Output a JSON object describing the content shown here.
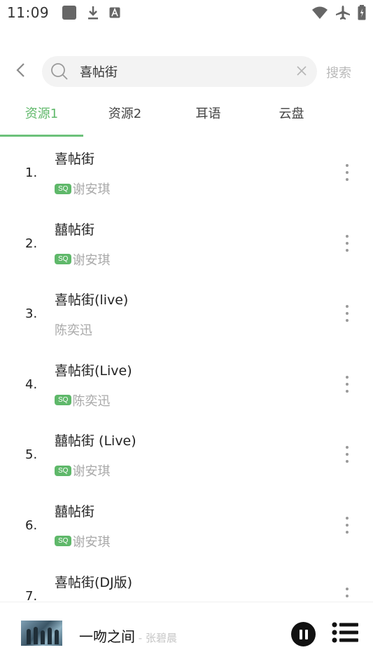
{
  "status_bar": {
    "time": "11:09",
    "left_icons": [
      "square-icon",
      "download-icon",
      "font-icon"
    ],
    "right_icons": [
      "wifi-icon",
      "airplane-icon",
      "battery-icon"
    ]
  },
  "search": {
    "value": "喜帖街",
    "submit_label": "搜索"
  },
  "tabs": [
    {
      "label": "资源1",
      "active": true
    },
    {
      "label": "资源2",
      "active": false
    },
    {
      "label": "耳语",
      "active": false
    },
    {
      "label": "云盘",
      "active": false
    }
  ],
  "results": [
    {
      "index": "1.",
      "title": "喜帖街",
      "badge": "SQ",
      "artist": "谢安琪"
    },
    {
      "index": "2.",
      "title": "囍帖街",
      "badge": "SQ",
      "artist": "谢安琪"
    },
    {
      "index": "3.",
      "title": "喜帖街(live)",
      "badge": "",
      "artist": "陈奕迅"
    },
    {
      "index": "4.",
      "title": "喜帖街(Live)",
      "badge": "SQ",
      "artist": "陈奕迅"
    },
    {
      "index": "5.",
      "title": "囍帖街 (Live)",
      "badge": "SQ",
      "artist": "谢安琪"
    },
    {
      "index": "6.",
      "title": "囍帖街",
      "badge": "SQ",
      "artist": "谢安琪"
    },
    {
      "index": "7.",
      "title": "喜帖街(DJ版)",
      "badge": "",
      "artist": ""
    }
  ],
  "now_playing": {
    "title": "一吻之间",
    "separator": " - ",
    "artist": "张碧晨"
  },
  "colors": {
    "accent": "#5fb86a",
    "muted": "#a9a9a9"
  }
}
